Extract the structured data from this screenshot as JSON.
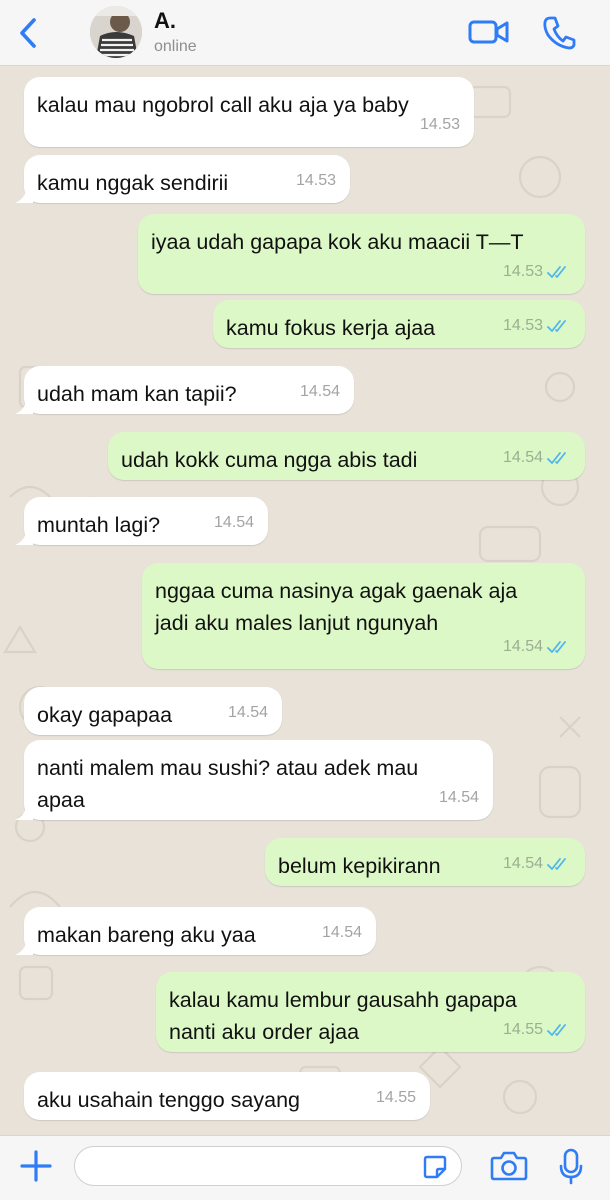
{
  "header": {
    "contact_name": "A.",
    "status": "online"
  },
  "colors": {
    "accent": "#2f7cf6",
    "outgoing_bubble": "#dcf8c6",
    "incoming_bubble": "#ffffff",
    "read_ticks": "#4fb6ec",
    "background": "#e8e2d9"
  },
  "icons": {
    "back": "chevron-left-icon",
    "video": "video-camera-icon",
    "call": "phone-icon",
    "add": "plus-icon",
    "sticker": "sticker-icon",
    "camera": "camera-icon",
    "mic": "microphone-icon"
  },
  "messages": [
    {
      "dir": "in",
      "lines": [
        "kalau mau ngobrol call aku aja ya baby"
      ],
      "time": "14.53"
    },
    {
      "dir": "in",
      "lines": [
        "kamu nggak sendirii"
      ],
      "time": "14.53"
    },
    {
      "dir": "out",
      "lines": [
        "iyaa udah gapapa kok aku maacii T—T"
      ],
      "time": "14.53",
      "read": true
    },
    {
      "dir": "out",
      "lines": [
        "kamu fokus kerja ajaa"
      ],
      "time": "14.53",
      "read": true
    },
    {
      "dir": "in",
      "lines": [
        "udah mam kan tapii?"
      ],
      "time": "14.54"
    },
    {
      "dir": "out",
      "lines": [
        "udah kokk cuma ngga abis tadi"
      ],
      "time": "14.54",
      "read": true
    },
    {
      "dir": "in",
      "lines": [
        "muntah lagi?"
      ],
      "time": "14.54"
    },
    {
      "dir": "out",
      "lines": [
        "nggaa cuma nasinya agak gaenak aja",
        "jadi aku males lanjut ngunyah"
      ],
      "time": "14.54",
      "read": true
    },
    {
      "dir": "in",
      "lines": [
        "okay gapapaa"
      ],
      "time": "14.54"
    },
    {
      "dir": "in",
      "lines": [
        "nanti malem mau sushi? atau adek mau",
        "apaa"
      ],
      "time": "14.54"
    },
    {
      "dir": "out",
      "lines": [
        "belum kepikirann"
      ],
      "time": "14.54",
      "read": true
    },
    {
      "dir": "in",
      "lines": [
        "makan bareng aku yaa"
      ],
      "time": "14.54"
    },
    {
      "dir": "out",
      "lines": [
        "kalau kamu lembur gausahh gapapa",
        "nanti aku order ajaa"
      ],
      "time": "14.55",
      "read": true
    },
    {
      "dir": "in",
      "lines": [
        "aku usahain tenggo sayang"
      ],
      "time": "14.55"
    }
  ],
  "composer": {
    "value": "",
    "placeholder": ""
  }
}
